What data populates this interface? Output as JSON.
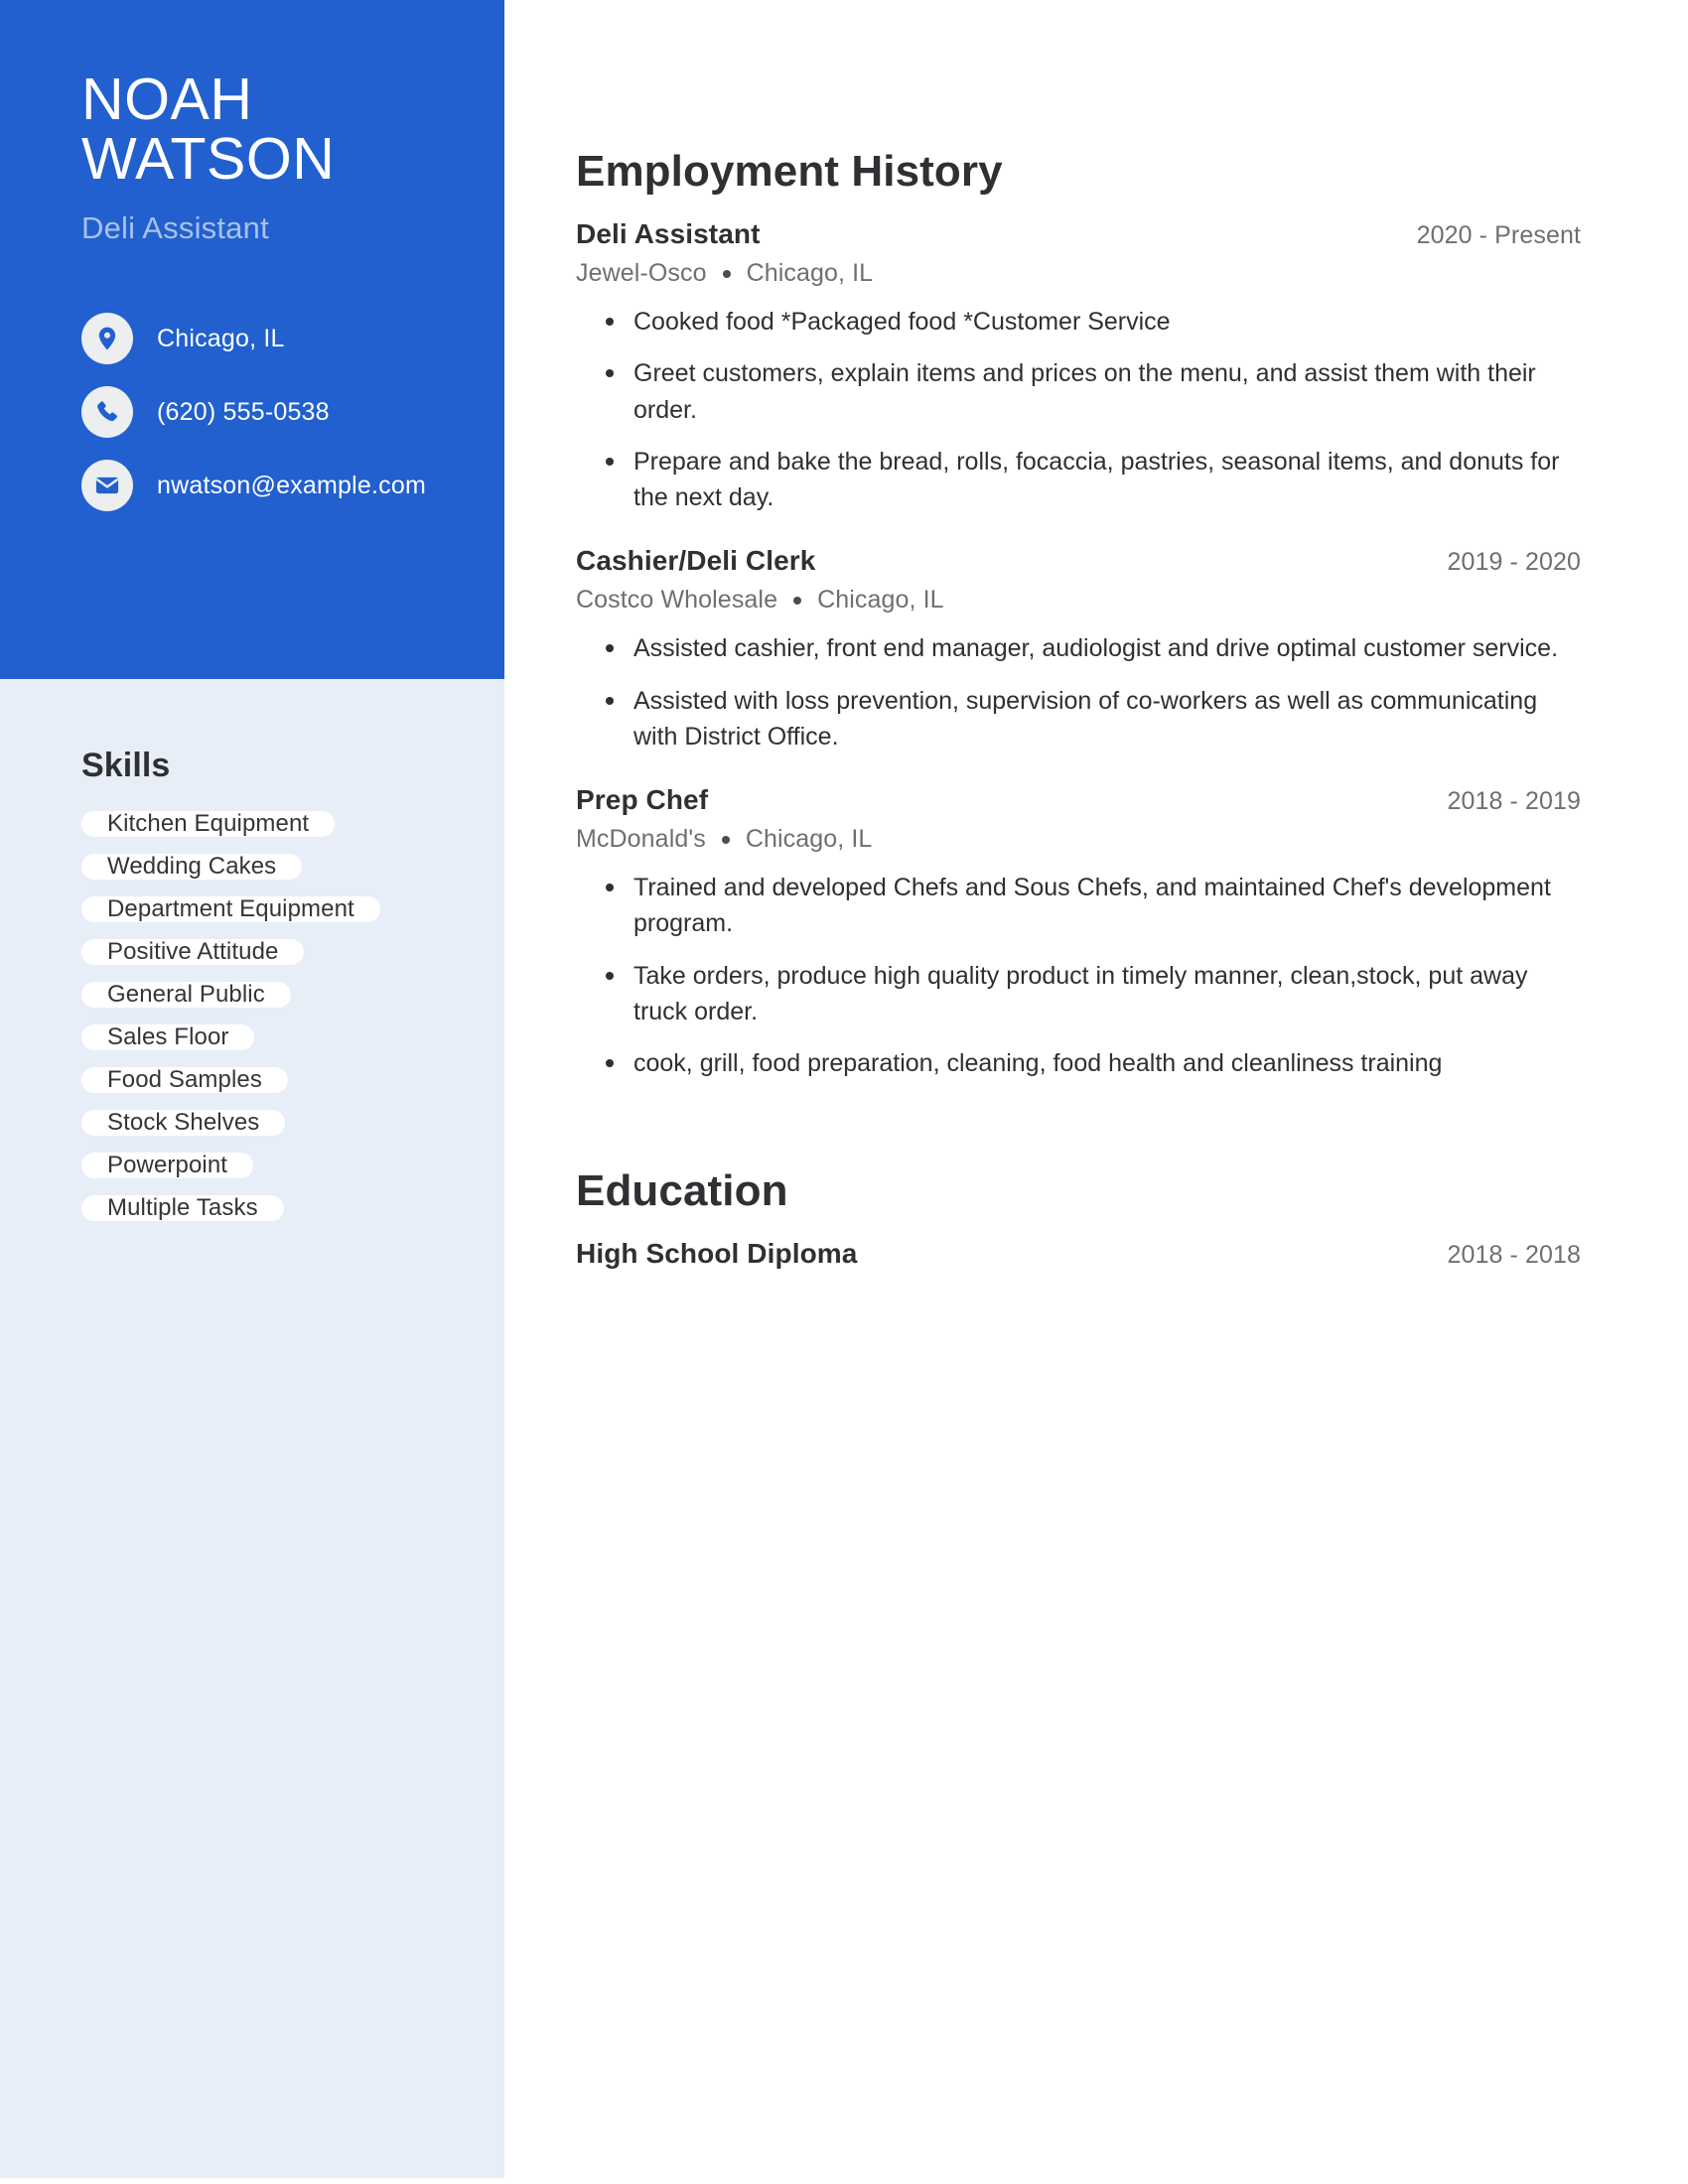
{
  "theme": {
    "accent": "#2160ce",
    "sidebar_bg": "#e8eef8",
    "pill_bg": "#ffffff",
    "text_dark": "#2f3033",
    "text_muted": "#6d6f73",
    "subtitle_color": "#a9c2ea"
  },
  "header": {
    "first_name": "NOAH",
    "last_name": "WATSON",
    "job_title": "Deli Assistant"
  },
  "contact": [
    {
      "icon": "location-pin-icon",
      "value": "Chicago, IL"
    },
    {
      "icon": "phone-icon",
      "value": "(620) 555-0538"
    },
    {
      "icon": "envelope-icon",
      "value": "nwatson@example.com"
    }
  ],
  "skills": {
    "heading": "Skills",
    "items": [
      "Kitchen Equipment",
      "Wedding Cakes",
      "Department Equipment",
      "Positive Attitude",
      "General Public",
      "Sales Floor",
      "Food Samples",
      "Stock Shelves",
      "Powerpoint",
      "Multiple Tasks"
    ]
  },
  "employment": {
    "heading": "Employment History",
    "entries": [
      {
        "role": "Deli Assistant",
        "dates": "2020 - Present",
        "company": "Jewel-Osco",
        "location": "Chicago, IL",
        "bullets": [
          "Cooked food *Packaged food *Customer Service",
          "Greet customers, explain items and prices on the menu, and assist them with their order.",
          "Prepare and bake the bread, rolls, focaccia, pastries, seasonal items, and donuts for the next day."
        ]
      },
      {
        "role": "Cashier/Deli Clerk",
        "dates": "2019 - 2020",
        "company": "Costco Wholesale",
        "location": "Chicago, IL",
        "bullets": [
          "Assisted cashier, front end manager, audiologist and drive optimal customer service.",
          "Assisted with loss prevention, supervision of co-workers as well as communicating with District Office."
        ]
      },
      {
        "role": "Prep Chef",
        "dates": "2018 - 2019",
        "company": "McDonald's",
        "location": "Chicago, IL",
        "bullets": [
          "Trained and developed Chefs and Sous Chefs, and maintained Chef's development program.",
          "Take orders, produce high quality product in timely manner, clean,stock, put away truck order.",
          "cook, grill, food preparation, cleaning, food health and cleanliness training"
        ]
      }
    ]
  },
  "education": {
    "heading": "Education",
    "entries": [
      {
        "degree": "High School Diploma",
        "dates": "2018 - 2018"
      }
    ]
  }
}
